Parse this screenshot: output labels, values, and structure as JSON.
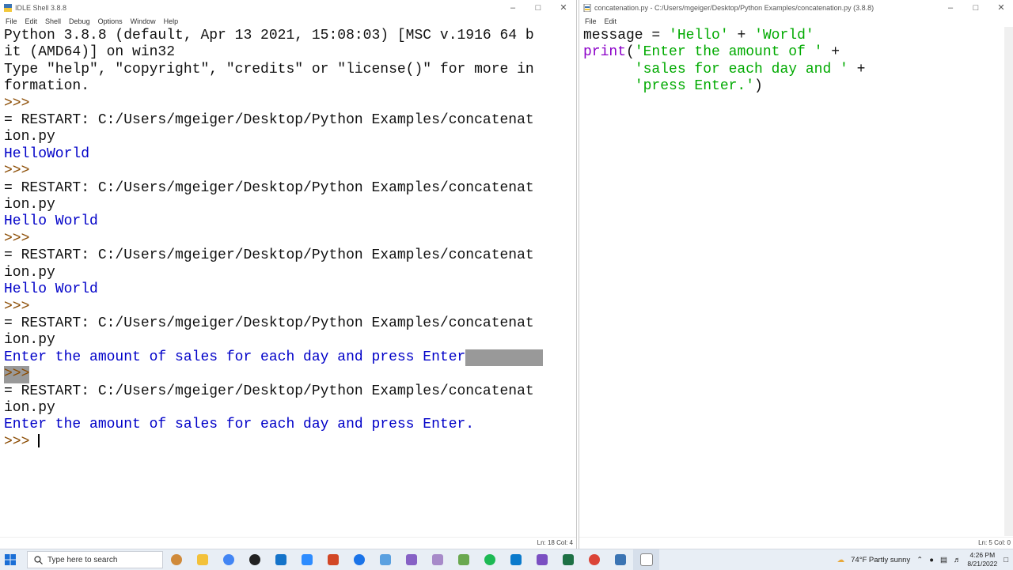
{
  "shell": {
    "title": "IDLE Shell 3.8.8",
    "menus": [
      "File",
      "Edit",
      "Shell",
      "Debug",
      "Options",
      "Window",
      "Help"
    ],
    "lines": [
      "Python 3.8.8 (default, Apr 13 2021, 15:08:03) [MSC v.1916 64 b",
      "it (AMD64)] on win32",
      "Type \"help\", \"copyright\", \"credits\" or \"license()\" for more in",
      "formation.",
      ">>>",
      "= RESTART: C:/Users/mgeiger/Desktop/Python Examples/concatenat",
      "ion.py",
      "HelloWorld",
      ">>>",
      "= RESTART: C:/Users/mgeiger/Desktop/Python Examples/concatenat",
      "ion.py",
      "Hello World",
      ">>>",
      "= RESTART: C:/Users/mgeiger/Desktop/Python Examples/concatenat",
      "ion.py",
      "Hello World",
      ">>>",
      "= RESTART: C:/Users/mgeiger/Desktop/Python Examples/concatenat",
      "ion.py",
      "Enter the amount of sales for each day and press Enter",
      ">>>",
      "= RESTART: C:/Users/mgeiger/Desktop/Python Examples/concatenat",
      "ion.py",
      "Enter the amount of sales for each day and press Enter.",
      ">>> "
    ],
    "status": "Ln: 18   Col: 4"
  },
  "editor": {
    "title": "concatenation.py - C:/Users/mgeiger/Desktop/Python Examples/concatenation.py (3.8.8)",
    "menus": [
      "File",
      "Edit"
    ],
    "lines": [
      "message = 'Hello' + 'World'",
      "print('Enter the amount of ' +",
      "      'sales for each day and ' +",
      "      'press Enter.')"
    ],
    "status": "Ln: 5   Col: 0"
  },
  "taskbar": {
    "search_placeholder": "Type here to search",
    "weather": "74°F  Partly sunny",
    "time": "4:26 PM",
    "date": "8/21/2022"
  },
  "colors": {
    "output": "#0000c8",
    "prompt": "#8a4a00",
    "string": "#00aa00",
    "builtin": "#8b00c8",
    "selection": "#999999"
  }
}
